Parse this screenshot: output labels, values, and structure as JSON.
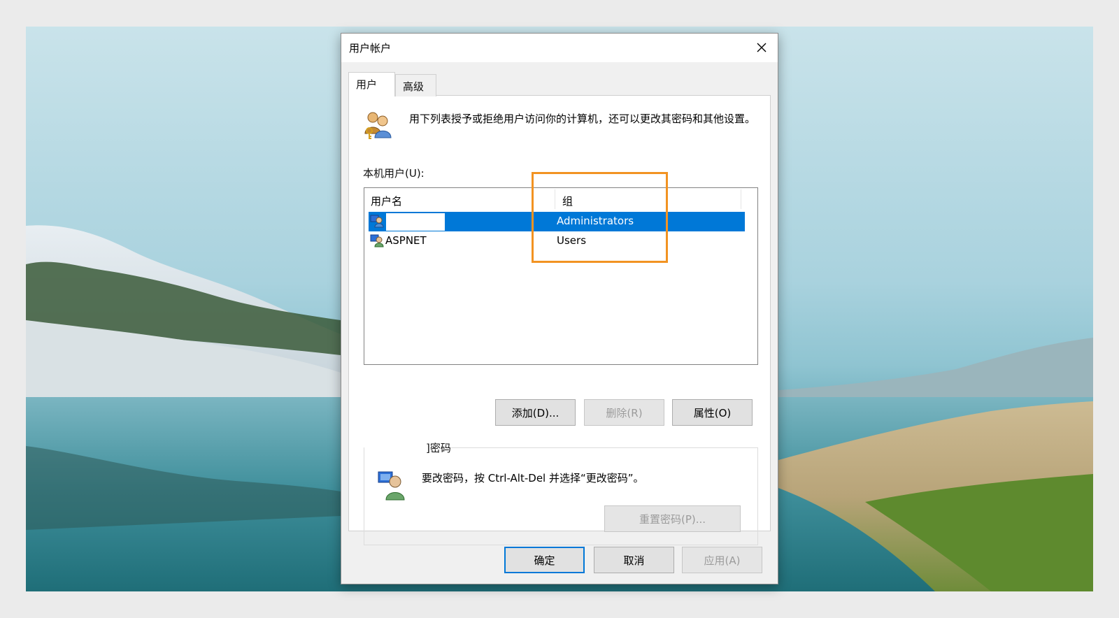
{
  "window": {
    "title": "用户帐户"
  },
  "tabs": [
    {
      "label": "用户",
      "selected": true
    },
    {
      "label": "高级",
      "selected": false
    }
  ],
  "intro": {
    "text": "用下列表授予或拒绝用户访问你的计算机，还可以更改其密码和其他设置。"
  },
  "local_users": {
    "label": "本机用户(U):",
    "columns": [
      "用户名",
      "组"
    ],
    "rows": [
      {
        "name": "",
        "group": "Administrators",
        "selected": true
      },
      {
        "name": "ASPNET",
        "group": "Users",
        "selected": false
      }
    ]
  },
  "buttons": {
    "add": "添加(D)...",
    "remove": "删除(R)",
    "properties": "属性(O)",
    "reset_password": "重置密码(P)...",
    "ok": "确定",
    "cancel": "取消",
    "apply": "应用(A)"
  },
  "password": {
    "legend": "]密码",
    "hint": "要改密码，按 Ctrl-Alt-Del 并选择“更改密码”。"
  },
  "colors": {
    "selection": "#0078d7",
    "highlight_box": "#f29322"
  }
}
